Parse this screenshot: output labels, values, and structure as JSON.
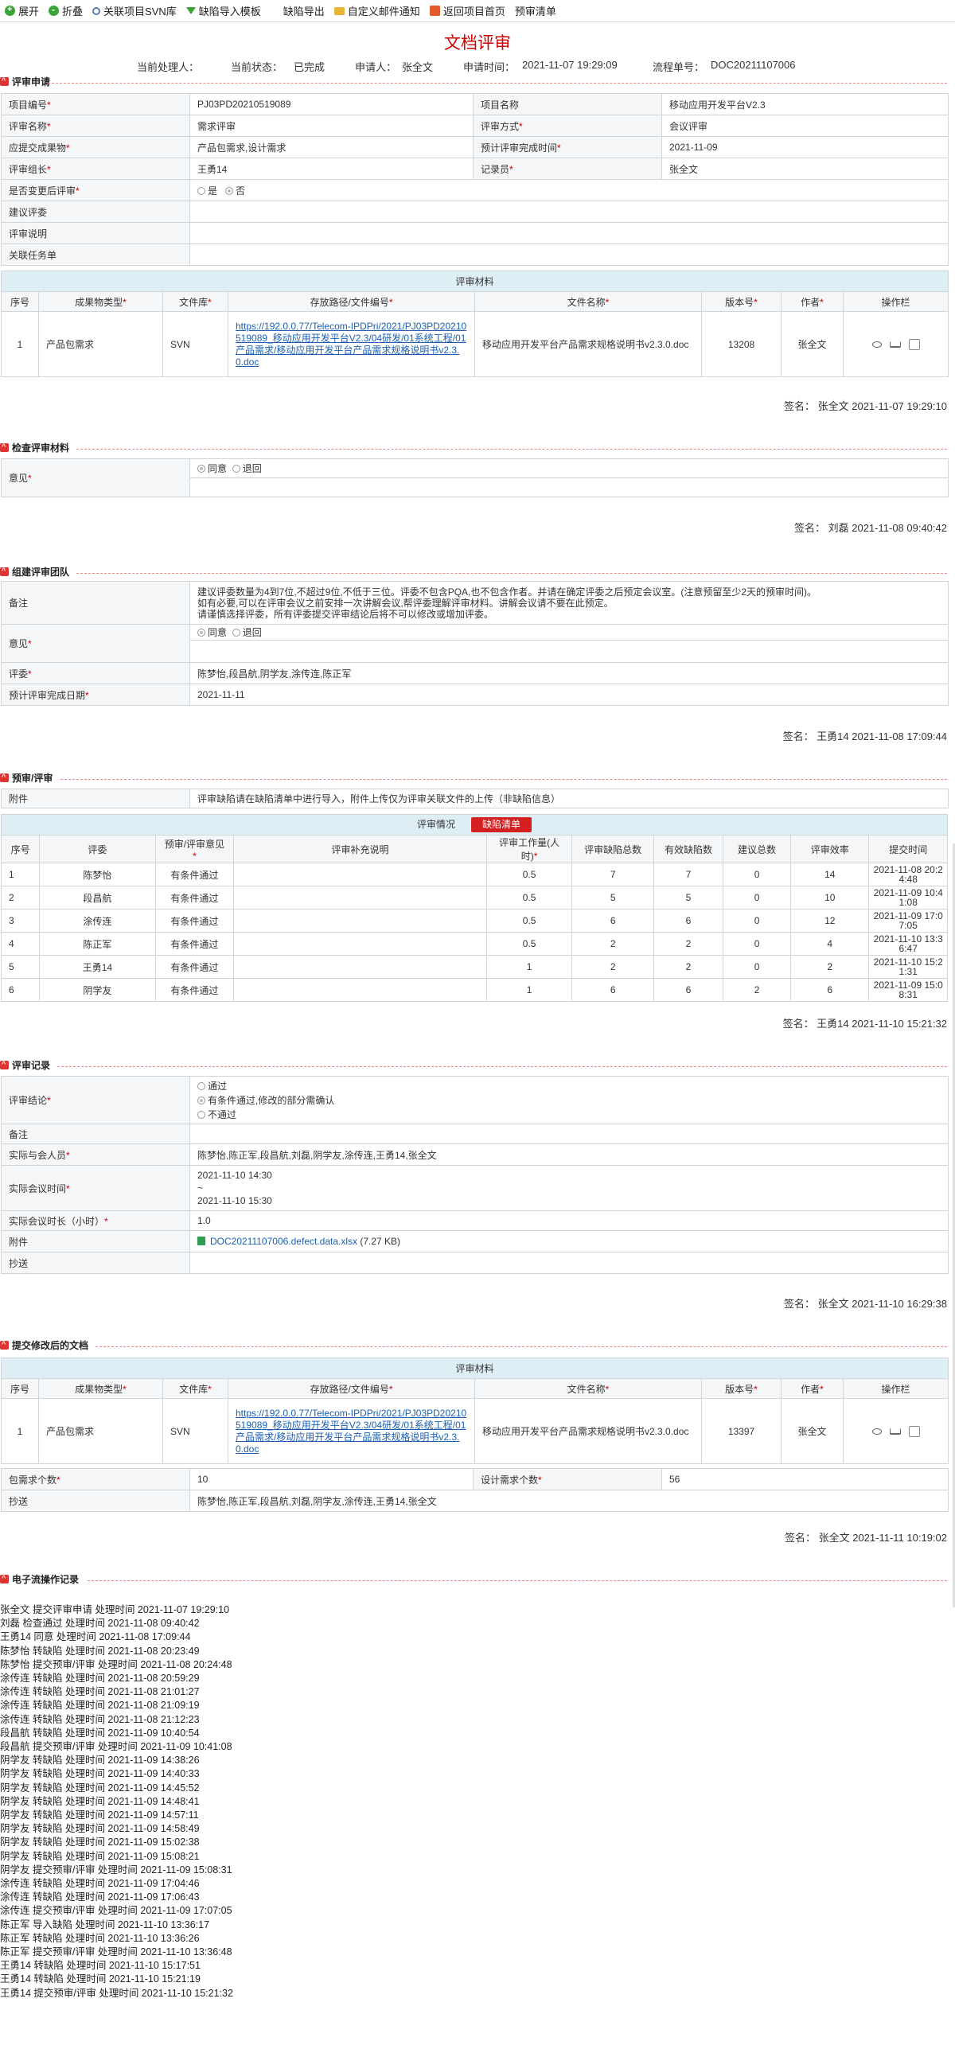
{
  "toolbar": {
    "expand": "展开",
    "collapse": "折叠",
    "link_svn": "关联项目SVN库",
    "import_template": "缺陷导入模板",
    "export_defects": "缺陷导出",
    "custom_mail": "自定义邮件通知",
    "back_home": "返回项目首页",
    "review_list": "预审清单"
  },
  "page_title": "文档评审",
  "meta": {
    "handler_label": "当前处理人：",
    "status_label": "当前状态：",
    "status_value": "已完成",
    "applicant_label": "申请人：",
    "applicant_value": "张全文",
    "apply_time_label": "申请时间：",
    "apply_time_value": "2021-11-07 19:29:09",
    "flow_label": "流程单号：",
    "flow_value": "DOC20211107006"
  },
  "apply": {
    "title": "评审申请",
    "project_no_label": "项目编号",
    "project_no": "PJ03PD20210519089",
    "project_name_label": "项目名称",
    "project_name": "移动应用开发平台V2.3",
    "review_name_label": "评审名称",
    "review_name": "需求评审",
    "review_mode_label": "评审方式",
    "review_mode": "会议评审",
    "deliverable_label": "应提交成果物",
    "deliverable": "产品包需求,设计需求",
    "planned_done_label": "预计评审完成时间",
    "planned_done": "2021-11-09",
    "leader_label": "评审组长",
    "leader": "王勇14",
    "recorder_label": "记录员",
    "recorder": "张全文",
    "post_change_label": "是否变更后评审",
    "opt_yes": "是",
    "opt_no": "否",
    "suggest_label": "建议评委",
    "note_label": "评审说明",
    "task_label": "关联任务单",
    "materials_band": "评审材料",
    "cols": [
      "序号",
      "成果物类型",
      "文件库",
      "存放路径/文件编号",
      "文件名称",
      "版本号",
      "作者",
      "操作栏"
    ],
    "row": {
      "no": "1",
      "type": "产品包需求",
      "repo": "SVN",
      "path": "https://192.0.0.77/Telecom-IPDPri/2021/PJ03PD20210519089_移动应用开发平台V2.3/04研发/01系统工程/01产品需求/移动应用开发平台产品需求规格说明书v2.3.0.doc",
      "file": "移动应用开发平台产品需求规格说明书v2.3.0.doc",
      "version": "13208",
      "author": "张全文"
    },
    "signature": "签名： 张全文 2021-11-07 19:29:10"
  },
  "check": {
    "title": "检查评审材料",
    "opinion_label": "意见",
    "agree": "同意",
    "reject": "退回",
    "signature": "签名： 刘磊 2021-11-08 09:40:42"
  },
  "team": {
    "title": "组建评审团队",
    "remark_label": "备注",
    "remark_lines": [
      "建议评委数量为4到7位,不超过9位,不低于三位。评委不包含PQA,也不包含作者。并请在确定评委之后预定会议室。(注意预留至少2天的预审时间)。",
      "如有必要,可以在评审会议之前安排一次讲解会议,帮评委理解评审材料。讲解会议请不要在此预定。",
      "请谨慎选择评委，所有评委提交评审结论后将不可以修改或增加评委。"
    ],
    "opinion_label": "意见",
    "agree": "同意",
    "reject": "退回",
    "reviewers_label": "评委",
    "reviewers": "陈梦怡,段昌航,阴学友,涂传连,陈正军",
    "planned_label": "预计评审完成日期",
    "planned": "2021-11-11",
    "signature": "签名： 王勇14 2021-11-08 17:09:44"
  },
  "pre": {
    "title": "预审/评审",
    "attach_label": "附件",
    "attach_note": "评审缺陷请在缺陷清单中进行导入，附件上传仅为评审关联文件的上传（非缺陷信息）",
    "status_band": "评审情况",
    "defect_btn": "缺陷清单",
    "cols": [
      "序号",
      "评委",
      "预审/评审意见",
      "评审补充说明",
      "评审工作量(人时)",
      "评审缺陷总数",
      "有效缺陷数",
      "建议总数",
      "评审效率",
      "提交时间"
    ],
    "rows": [
      {
        "no": "1",
        "name": "陈梦怡",
        "opinion": "有条件通过",
        "note": "",
        "effort": "0.5",
        "defects": "7",
        "valid": "7",
        "suggest": "0",
        "eff": "14",
        "time": "2021-11-08 20:24:48"
      },
      {
        "no": "2",
        "name": "段昌航",
        "opinion": "有条件通过",
        "note": "",
        "effort": "0.5",
        "defects": "5",
        "valid": "5",
        "suggest": "0",
        "eff": "10",
        "time": "2021-11-09 10:41:08"
      },
      {
        "no": "3",
        "name": "涂传连",
        "opinion": "有条件通过",
        "note": "",
        "effort": "0.5",
        "defects": "6",
        "valid": "6",
        "suggest": "0",
        "eff": "12",
        "time": "2021-11-09 17:07:05"
      },
      {
        "no": "4",
        "name": "陈正军",
        "opinion": "有条件通过",
        "note": "",
        "effort": "0.5",
        "defects": "2",
        "valid": "2",
        "suggest": "0",
        "eff": "4",
        "time": "2021-11-10 13:36:47"
      },
      {
        "no": "5",
        "name": "王勇14",
        "opinion": "有条件通过",
        "note": "",
        "effort": "1",
        "defects": "2",
        "valid": "2",
        "suggest": "0",
        "eff": "2",
        "time": "2021-11-10 15:21:31"
      },
      {
        "no": "6",
        "name": "阴学友",
        "opinion": "有条件通过",
        "note": "",
        "effort": "1",
        "defects": "6",
        "valid": "6",
        "suggest": "2",
        "eff": "6",
        "time": "2021-11-09 15:08:31"
      }
    ],
    "signature": "签名： 王勇14 2021-11-10 15:21:32"
  },
  "record": {
    "title": "评审记录",
    "conclusion_label": "评审结论",
    "opt_pass": "通过",
    "opt_cond": "有条件通过,修改的部分需确认",
    "opt_fail": "不通过",
    "remark_label": "备注",
    "attendees_label": "实际与会人员",
    "attendees": "陈梦怡,陈正军,段昌航,刘磊,阴学友,涂传连,王勇14,张全文",
    "meeting_time_label": "实际会议时间",
    "meeting_start": "2021-11-10 14:30",
    "meeting_sep": "~",
    "meeting_end": "2021-11-10 15:30",
    "duration_label": "实际会议时长（小时）",
    "duration": "1.0",
    "attach_label": "附件",
    "attach_file": "DOC20211107006.defect.data.xlsx",
    "attach_size": "(7.27 KB)",
    "cc_label": "抄送",
    "signature": "签名： 张全文 2021-11-10 16:29:38"
  },
  "revised": {
    "title": "提交修改后的文档",
    "materials_band": "评审材料",
    "cols": [
      "序号",
      "成果物类型",
      "文件库",
      "存放路径/文件编号",
      "文件名称",
      "版本号",
      "作者",
      "操作栏"
    ],
    "row": {
      "no": "1",
      "type": "产品包需求",
      "repo": "SVN",
      "path": "https://192.0.0.77/Telecom-IPDPri/2021/PJ03PD20210519089_移动应用开发平台V2.3/04研发/01系统工程/01产品需求/移动应用开发平台产品需求规格说明书v2.3.0.doc",
      "file": "移动应用开发平台产品需求规格说明书v2.3.0.doc",
      "version": "13397",
      "author": "张全文"
    },
    "pkg_count_label": "包需求个数",
    "pkg_count": "10",
    "design_count_label": "设计需求个数",
    "design_count": "56",
    "cc_label": "抄送",
    "cc": "陈梦怡,陈正军,段昌航,刘磊,阴学友,涂传连,王勇14,张全文",
    "signature": "签名： 张全文 2021-11-11 10:19:02"
  },
  "logs": {
    "title": "电子流操作记录",
    "lines": [
      "张全文 提交评审申请 处理时间 2021-11-07 19:29:10",
      "刘磊 检查通过 处理时间 2021-11-08 09:40:42",
      "王勇14 同意 处理时间 2021-11-08 17:09:44",
      "陈梦怡 转缺陷 处理时间 2021-11-08 20:23:49",
      "陈梦怡 提交预审/评审 处理时间 2021-11-08 20:24:48",
      "涂传连 转缺陷 处理时间 2021-11-08 20:59:29",
      "涂传连 转缺陷 处理时间 2021-11-08 21:01:27",
      "涂传连 转缺陷 处理时间 2021-11-08 21:09:19",
      "涂传连 转缺陷 处理时间 2021-11-08 21:12:23",
      "段昌航 转缺陷 处理时间 2021-11-09 10:40:54",
      "段昌航 提交预审/评审 处理时间 2021-11-09 10:41:08",
      "阴学友 转缺陷 处理时间 2021-11-09 14:38:26",
      "阴学友 转缺陷 处理时间 2021-11-09 14:40:33",
      "阴学友 转缺陷 处理时间 2021-11-09 14:45:52",
      "阴学友 转缺陷 处理时间 2021-11-09 14:48:41",
      "阴学友 转缺陷 处理时间 2021-11-09 14:57:11",
      "阴学友 转缺陷 处理时间 2021-11-09 14:58:49",
      "阴学友 转缺陷 处理时间 2021-11-09 15:02:38",
      "阴学友 转缺陷 处理时间 2021-11-09 15:08:21",
      "阴学友 提交预审/评审 处理时间 2021-11-09 15:08:31",
      "涂传连 转缺陷 处理时间 2021-11-09 17:04:46",
      "涂传连 转缺陷 处理时间 2021-11-09 17:06:43",
      "涂传连 提交预审/评审 处理时间 2021-11-09 17:07:05",
      "陈正军 导入缺陷 处理时间 2021-11-10 13:36:17",
      "陈正军 转缺陷 处理时间 2021-11-10 13:36:26",
      "陈正军 提交预审/评审 处理时间 2021-11-10 13:36:48",
      "王勇14 转缺陷 处理时间 2021-11-10 15:17:51",
      "王勇14 转缺陷 处理时间 2021-11-10 15:21:19",
      "王勇14 提交预审/评审 处理时间 2021-11-10 15:21:32"
    ]
  }
}
